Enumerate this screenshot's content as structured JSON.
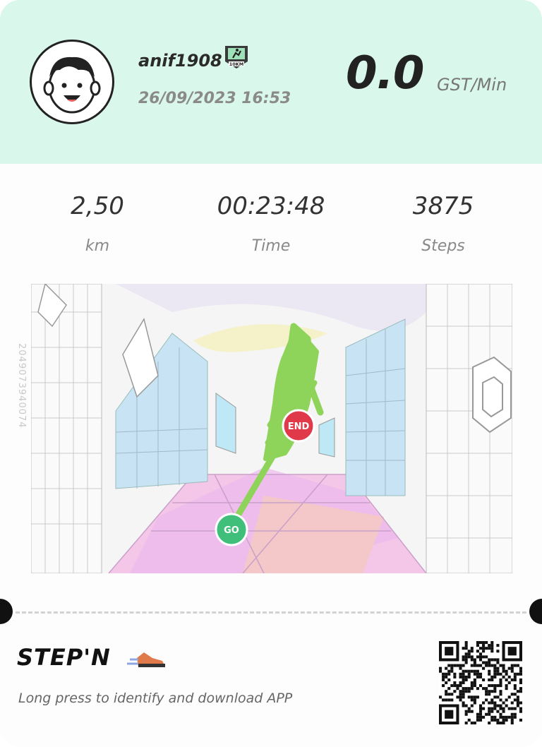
{
  "profile": {
    "username": "anif1908",
    "badge_label": "10KM",
    "datetime": "26/09/2023 16:53"
  },
  "earnings": {
    "rate_value": "0.0",
    "rate_unit": "GST/Min"
  },
  "stats": [
    {
      "value": "2,50",
      "label": "km"
    },
    {
      "value": "00:23:48",
      "label": "Time"
    },
    {
      "value": "3875",
      "label": "Steps"
    }
  ],
  "map": {
    "serial": "2049073940074",
    "start_label": "GO",
    "end_label": "END",
    "route_color": "#8fd45a",
    "start_color": "#3fbf7a",
    "end_color": "#e0394a"
  },
  "footer": {
    "brand": "STEP'N",
    "hint": "Long press to identify and download APP"
  },
  "colors": {
    "header_bg": "#d9f7ea"
  }
}
